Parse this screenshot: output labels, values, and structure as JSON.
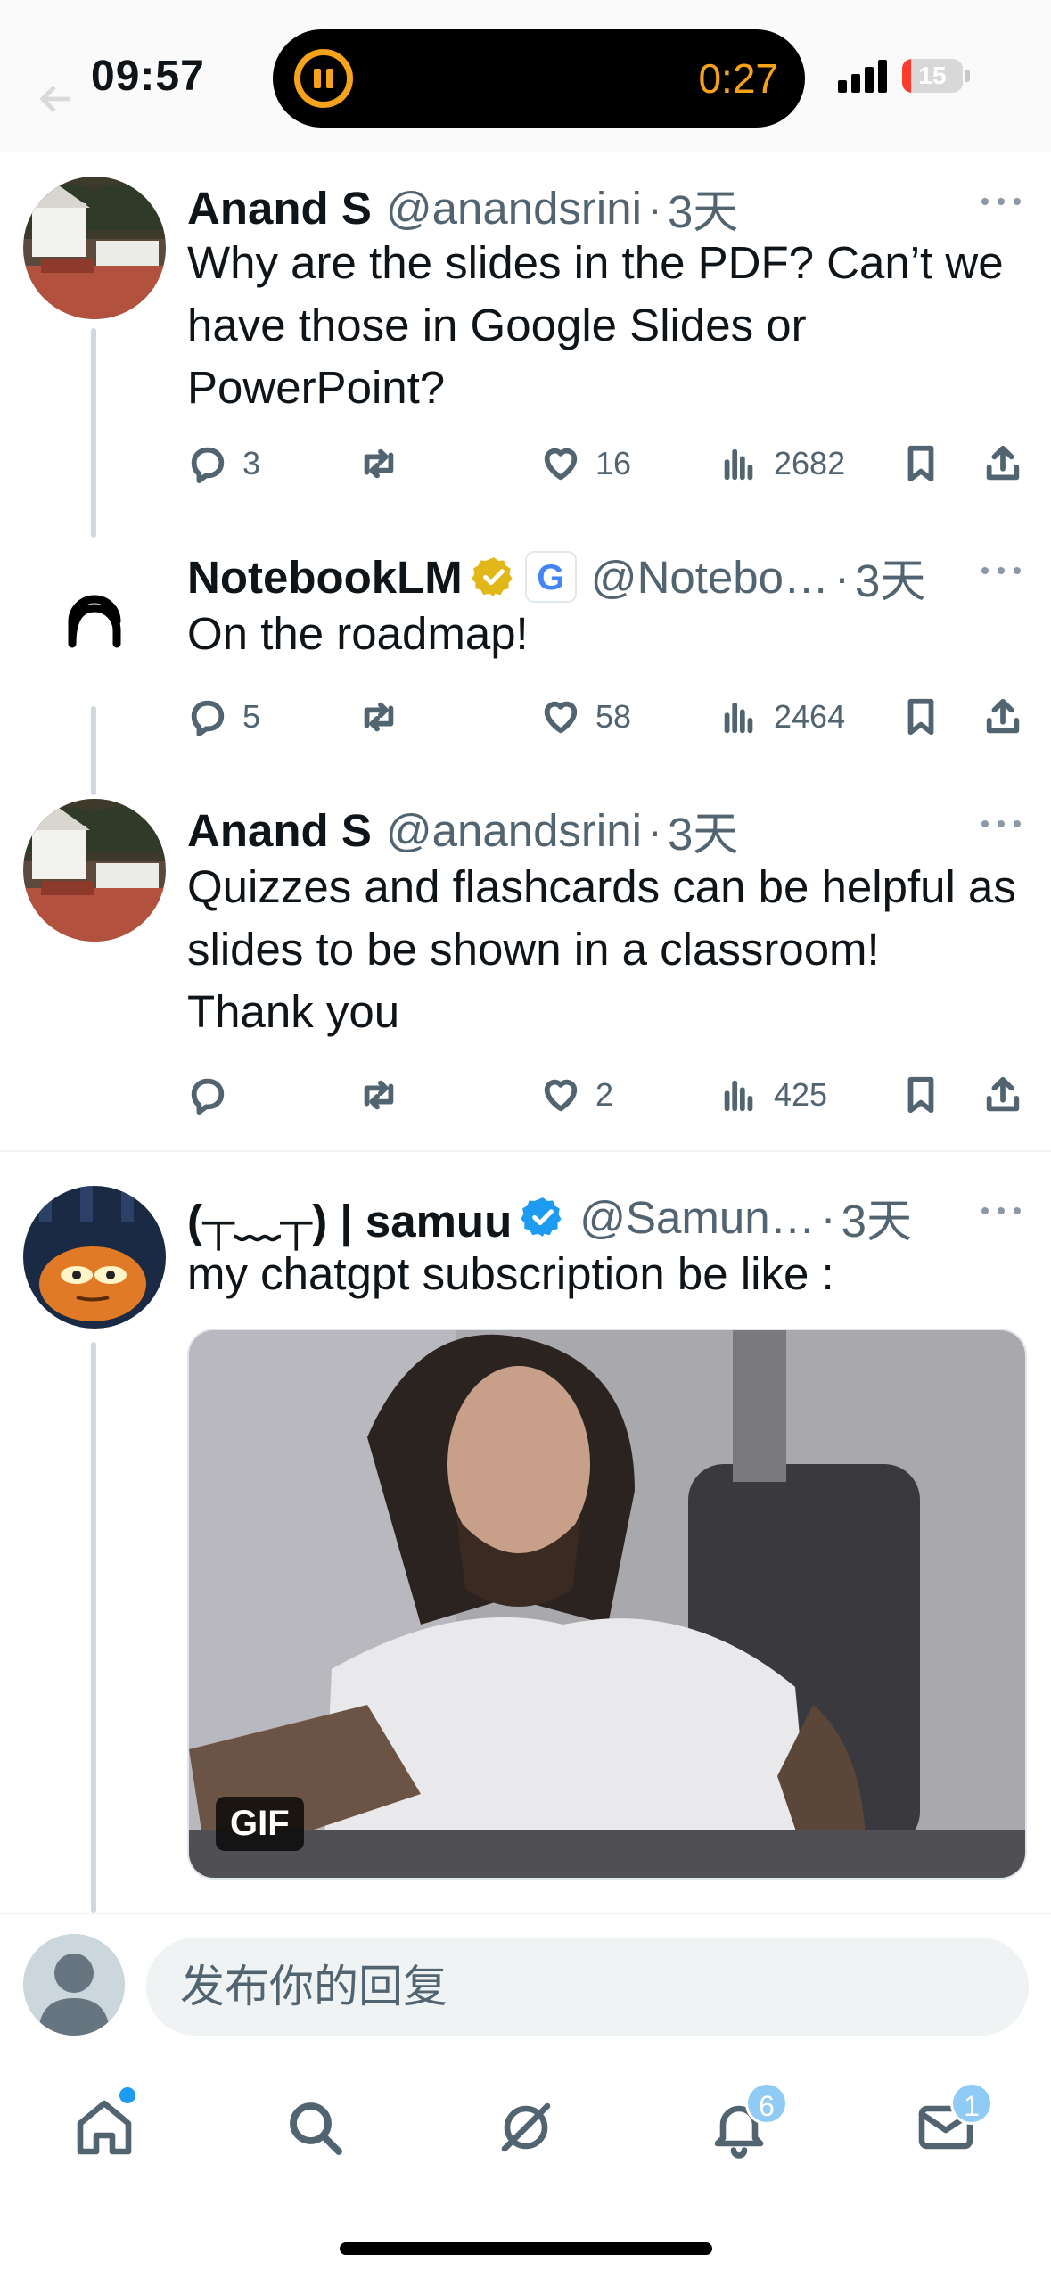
{
  "status_bar": {
    "time": "09:57",
    "recording_timer": "0:27",
    "battery_level": "15"
  },
  "tweets": [
    {
      "name": "Anand S",
      "handle": "@anandsrini",
      "dot": "·",
      "age": "3天",
      "text": "Why are the slides in the PDF? Can’t we have those in Google Slides or PowerPoint?",
      "replies": "3",
      "retweets": "",
      "likes": "16",
      "views": "2682"
    },
    {
      "name": "NotebookLM",
      "handle": "@Notebo…",
      "dot": "·",
      "age": "3天",
      "affiliate_badge_letter": "G",
      "text": "On the roadmap!",
      "replies": "5",
      "retweets": "",
      "likes": "58",
      "views": "2464"
    },
    {
      "name": "Anand S",
      "handle": "@anandsrini",
      "dot": "·",
      "age": "3天",
      "text": "Quizzes and flashcards can be helpful as slides to be shown in a classroom! Thank you",
      "replies": "",
      "retweets": "",
      "likes": "2",
      "views": "425"
    },
    {
      "name": "(┬﹏┬) | samuu",
      "handle": "@Samun…",
      "dot": "·",
      "age": "3天",
      "text": "my chatgpt subscription be like :",
      "media_badge": "GIF"
    }
  ],
  "reply_bar": {
    "placeholder": "发布你的回复"
  },
  "tab_bar": {
    "notifications_count": "6",
    "messages_count": "1"
  },
  "colors": {
    "accent": "#1d9bf0",
    "recording": "#f7a21b",
    "gold_badge": "#e2b719",
    "muted_text": "#536471"
  }
}
